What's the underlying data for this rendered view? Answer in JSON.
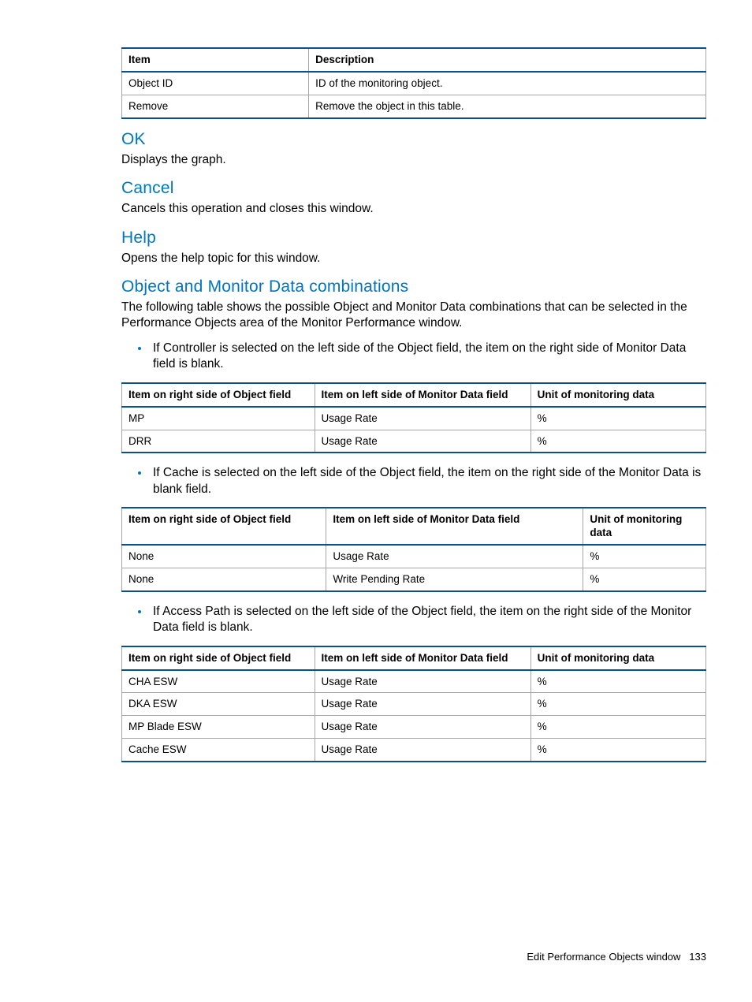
{
  "table1": {
    "headers": [
      "Item",
      "Description"
    ],
    "rows": [
      [
        "Object ID",
        "ID of the monitoring object."
      ],
      [
        "Remove",
        "Remove the object in this table."
      ]
    ]
  },
  "sections": {
    "ok": {
      "heading": "OK",
      "body": "Displays the graph."
    },
    "cancel": {
      "heading": "Cancel",
      "body": "Cancels this operation and closes this window."
    },
    "help": {
      "heading": "Help",
      "body": "Opens the help topic for this window."
    },
    "combos": {
      "heading": "Object and Monitor Data combinations",
      "body": "The following table shows the possible Object and Monitor Data combinations that can be selected in the Performance Objects area of the Monitor Performance window."
    }
  },
  "bullets": {
    "b1": "If Controller is selected on the left side of the Object field, the item on the right side of Monitor Data field is blank.",
    "b2": "If Cache is selected on the left side of the Object field, the item on the right side of the Monitor Data is blank field.",
    "b3": "If Access Path is selected on the left side of the Object field, the item on the right side of the Monitor Data field is blank."
  },
  "headers3": [
    "Item on right side of Object field",
    "Item on left side of Monitor Data field",
    "Unit of monitoring data"
  ],
  "table2": {
    "rows": [
      [
        "MP",
        "Usage Rate",
        "%"
      ],
      [
        "DRR",
        "Usage Rate",
        "%"
      ]
    ]
  },
  "table3": {
    "rows": [
      [
        "None",
        "Usage Rate",
        "%"
      ],
      [
        "None",
        "Write Pending Rate",
        "%"
      ]
    ]
  },
  "table4": {
    "rows": [
      [
        "CHA ESW",
        "Usage Rate",
        "%"
      ],
      [
        "DKA ESW",
        "Usage Rate",
        "%"
      ],
      [
        "MP Blade ESW",
        "Usage Rate",
        "%"
      ],
      [
        "Cache ESW",
        "Usage Rate",
        "%"
      ]
    ]
  },
  "footer": {
    "text": "Edit Performance Objects window",
    "page": "133"
  }
}
